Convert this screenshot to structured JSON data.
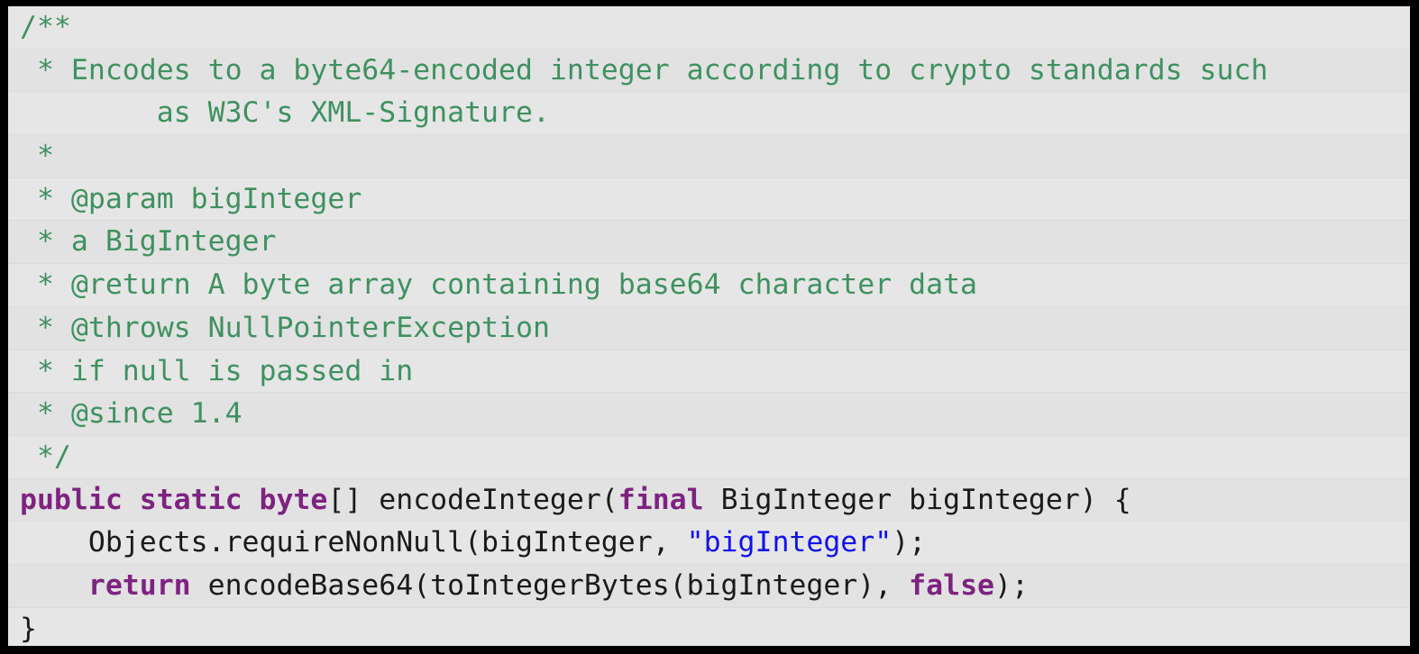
{
  "editor": {
    "language": "Java",
    "background_color": "#e6e6e6",
    "alt_row_color": "#e2e2e2",
    "frame_color": "#000000",
    "row_separator_color": "#dcdcdc",
    "colors": {
      "comment": "#3f9160",
      "keyword": "#7d2380",
      "string": "#1111ee",
      "plain": "#1a1a1a"
    }
  },
  "code": {
    "lines": [
      {
        "id": "line-1",
        "tokens": [
          {
            "text": "/**",
            "type": "comment"
          }
        ]
      },
      {
        "id": "line-2",
        "tokens": [
          {
            "text": " * Encodes to a byte64-encoded integer according to crypto standards such",
            "type": "comment"
          }
        ]
      },
      {
        "id": "line-2-wrap",
        "tokens": [
          {
            "text": "        as W3C's XML-Signature.",
            "type": "comment"
          }
        ]
      },
      {
        "id": "line-3",
        "tokens": [
          {
            "text": " *",
            "type": "comment"
          }
        ]
      },
      {
        "id": "line-4",
        "tokens": [
          {
            "text": " * @param bigInteger",
            "type": "comment"
          }
        ]
      },
      {
        "id": "line-5",
        "tokens": [
          {
            "text": " * a BigInteger",
            "type": "comment"
          }
        ]
      },
      {
        "id": "line-6",
        "tokens": [
          {
            "text": " * @return A byte array containing base64 character data",
            "type": "comment"
          }
        ]
      },
      {
        "id": "line-7",
        "tokens": [
          {
            "text": " * @throws NullPointerException",
            "type": "comment"
          }
        ]
      },
      {
        "id": "line-8",
        "tokens": [
          {
            "text": " * if null is passed in",
            "type": "comment"
          }
        ]
      },
      {
        "id": "line-9",
        "tokens": [
          {
            "text": " * @since 1.4",
            "type": "comment"
          }
        ]
      },
      {
        "id": "line-10",
        "tokens": [
          {
            "text": " */",
            "type": "comment"
          }
        ]
      },
      {
        "id": "line-11",
        "tokens": [
          {
            "text": "public static byte",
            "type": "keyword"
          },
          {
            "text": "[] encodeInteger(",
            "type": "plain"
          },
          {
            "text": "final",
            "type": "keyword"
          },
          {
            "text": " BigInteger bigInteger) {",
            "type": "plain"
          }
        ]
      },
      {
        "id": "line-12",
        "tokens": [
          {
            "text": "    Objects.requireNonNull(bigInteger, ",
            "type": "plain"
          },
          {
            "text": "\"bigInteger\"",
            "type": "string"
          },
          {
            "text": ");",
            "type": "plain"
          }
        ]
      },
      {
        "id": "line-13",
        "tokens": [
          {
            "text": "    ",
            "type": "plain"
          },
          {
            "text": "return",
            "type": "keyword"
          },
          {
            "text": " encodeBase64(toIntegerBytes(bigInteger), ",
            "type": "plain"
          },
          {
            "text": "false",
            "type": "keyword"
          },
          {
            "text": ");",
            "type": "plain"
          }
        ]
      },
      {
        "id": "line-14",
        "tokens": [
          {
            "text": "}",
            "type": "plain"
          }
        ]
      }
    ]
  }
}
